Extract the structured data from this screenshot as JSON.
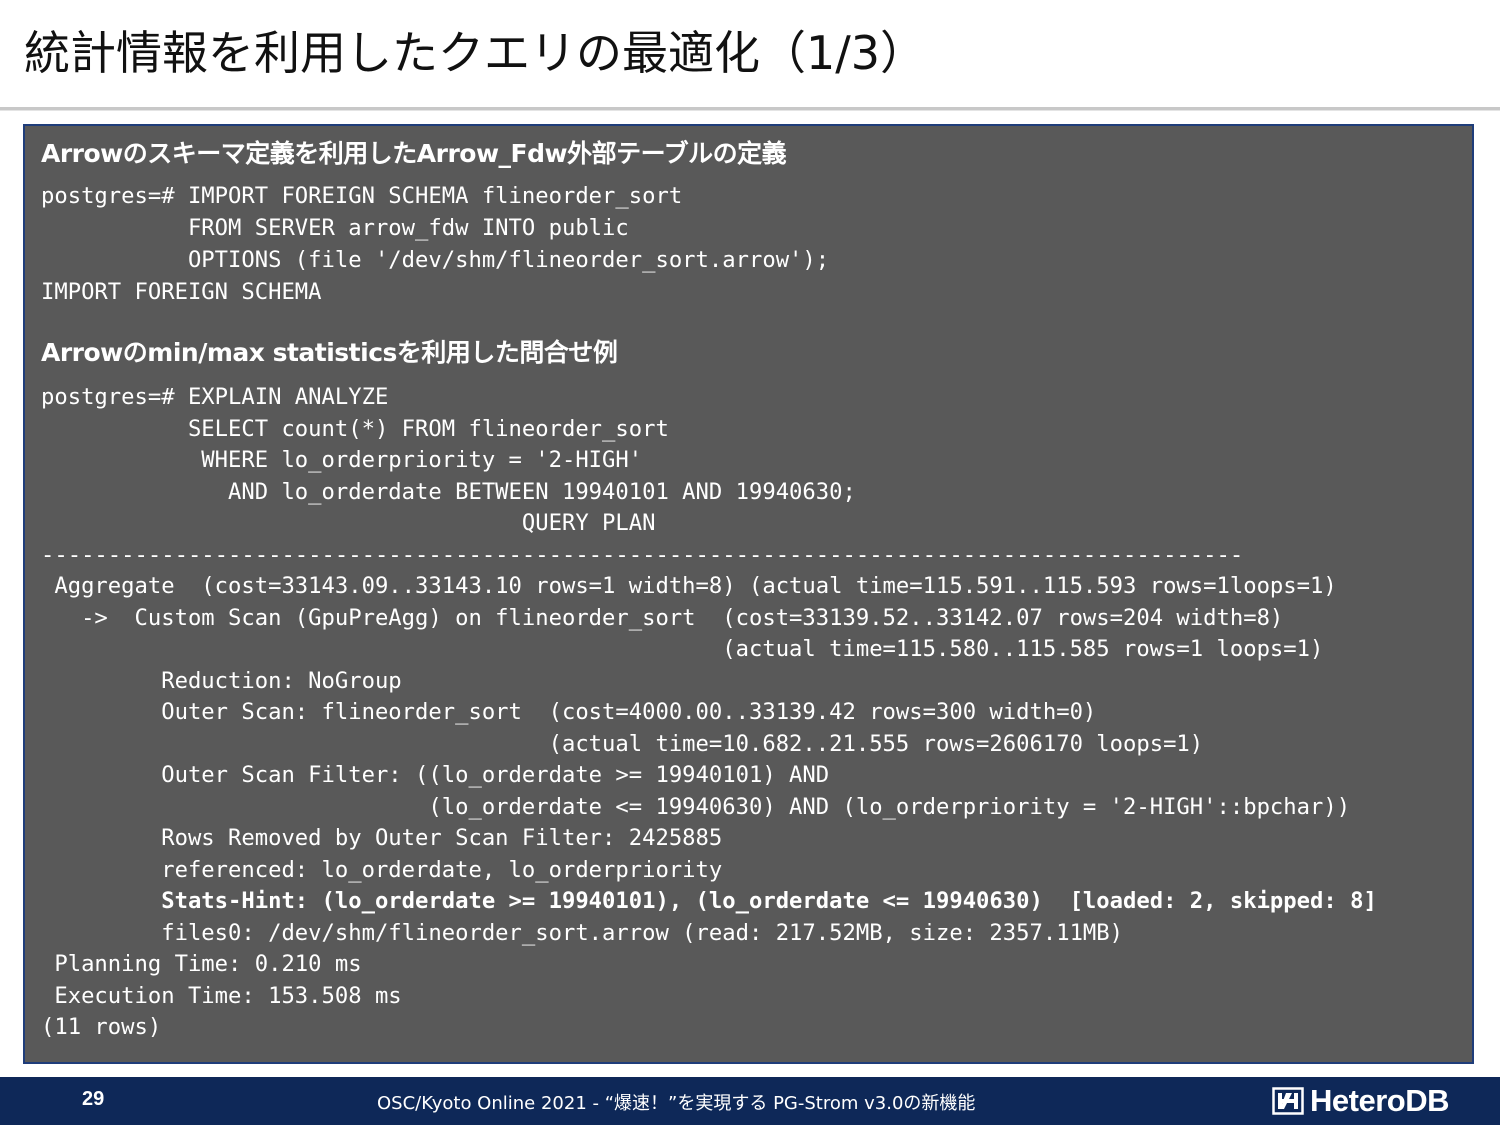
{
  "slide": {
    "title": "統計情報を利用したクエリの最適化（1/3）"
  },
  "section1": {
    "heading": "Arrowのスキーマ定義を利用したArrow_Fdw外部テーブルの定義",
    "code_lines": [
      "postgres=# IMPORT FOREIGN SCHEMA flineorder_sort",
      "           FROM SERVER arrow_fdw INTO public",
      "           OPTIONS (file '/dev/shm/flineorder_sort.arrow');",
      "IMPORT FOREIGN SCHEMA"
    ]
  },
  "section2": {
    "heading": "Arrowのmin/max statisticsを利用した問合せ例",
    "code_lines": [
      "postgres=# EXPLAIN ANALYZE",
      "           SELECT count(*) FROM flineorder_sort",
      "            WHERE lo_orderpriority = '2-HIGH'",
      "              AND lo_orderdate BETWEEN 19940101 AND 19940630;",
      "                                    QUERY PLAN",
      "------------------------------------------------------------------------------------------",
      " Aggregate  (cost=33143.09..33143.10 rows=1 width=8) (actual time=115.591..115.593 rows=1loops=1)",
      "   ->  Custom Scan (GpuPreAgg) on flineorder_sort  (cost=33139.52..33142.07 rows=204 width=8)",
      "                                                   (actual time=115.580..115.585 rows=1 loops=1)",
      "         Reduction: NoGroup",
      "         Outer Scan: flineorder_sort  (cost=4000.00..33139.42 rows=300 width=0)",
      "                                      (actual time=10.682..21.555 rows=2606170 loops=1)",
      "         Outer Scan Filter: ((lo_orderdate >= 19940101) AND",
      "                             (lo_orderdate <= 19940630) AND (lo_orderpriority = '2-HIGH'::bpchar))",
      "         Rows Removed by Outer Scan Filter: 2425885",
      "         referenced: lo_orderdate, lo_orderpriority",
      "         Stats-Hint: (lo_orderdate >= 19940101), (lo_orderdate <= 19940630)  [loaded: 2, skipped: 8]",
      "         files0: /dev/shm/flineorder_sort.arrow (read: 217.52MB, size: 2357.11MB)",
      " Planning Time: 0.210 ms",
      " Execution Time: 153.508 ms",
      "(11 rows)"
    ]
  },
  "footer": {
    "page_number": "29",
    "text": "OSC/Kyoto Online 2021 - “爆速！”を実現する PG-Strom v3.0の新機能",
    "brand_name": "HeteroDB",
    "brand_icon": "heterodb-logo-icon"
  },
  "colors": {
    "content_background": "#595959",
    "content_border": "#1f3d7a",
    "footer_background": "#0e2858",
    "text_light": "#ffffff",
    "title_text": "#111111"
  }
}
